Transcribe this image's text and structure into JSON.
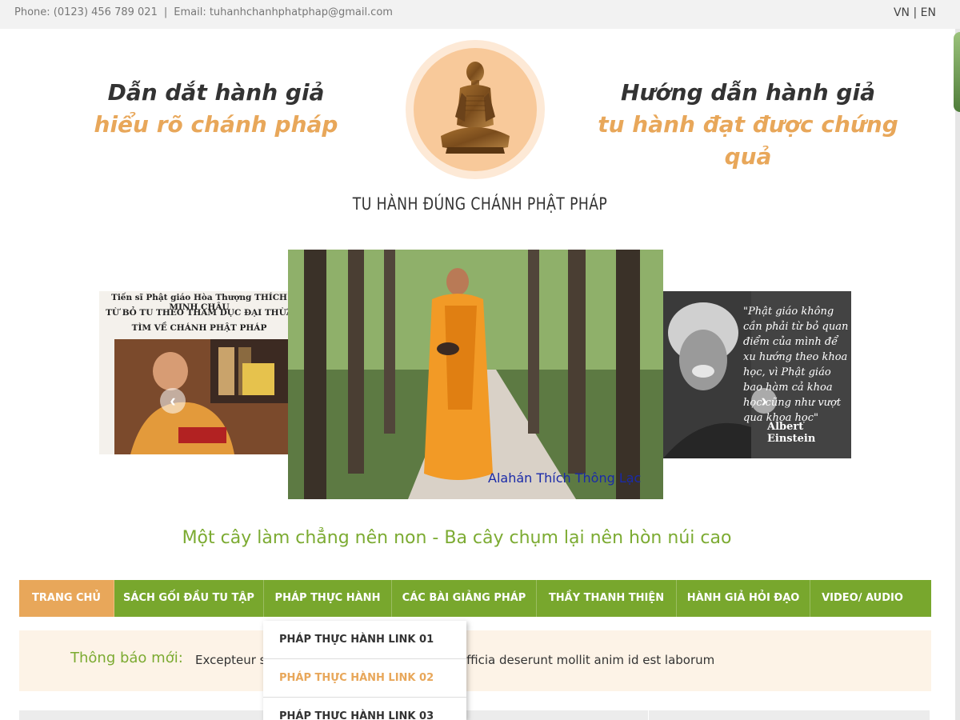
{
  "topbar": {
    "phone": "Phone: (0123) 456 789 021",
    "separator": "|",
    "email": "Email: tuhanhchanhphatphap@gmail.com",
    "lang_vn": "VN",
    "lang_sep": "|",
    "lang_en": "EN"
  },
  "header": {
    "left_line1": "Dẫn dắt hành giả",
    "left_line2": "hiểu rõ chánh pháp",
    "right_line1": "Hướng dẫn hành giả",
    "right_line2": "tu hành đạt được chứng quả",
    "logo_title": "TU HÀNH ĐÚNG CHÁNH PHẬT PHÁP"
  },
  "slider": {
    "left_caption_1": "Tiến sĩ Phật giáo Hòa Thượng THÍCH MINH CHÂU",
    "left_caption_2": "TỪ BỎ TU THEO THAM DỤC ĐẠI THỪA",
    "left_caption_3": "TÌM VỀ CHÁNH PHẬT PHÁP",
    "center_caption": "Alahán Thích Thông Lạc",
    "right_quote": "\"Phật giáo không cần phải từ bỏ quan điểm của mình để xu hướng theo khoa học, vì Phật giáo bao hàm cả khoa học cũng như vượt qua khoa học\"",
    "right_author": "Albert Einstein",
    "prev": "‹",
    "next": "›"
  },
  "proverb": "Một cây làm chẳng nên non - Ba cây chụm lại nên hòn núi cao",
  "nav": {
    "items": [
      {
        "label": "TRANG CHỦ"
      },
      {
        "label": "SÁCH GỐI ĐẦU TU TẬP"
      },
      {
        "label": "PHÁP THỰC HÀNH"
      },
      {
        "label": "CÁC BÀI GIẢNG PHÁP"
      },
      {
        "label": "THẦY THANH THIỆN"
      },
      {
        "label": "HÀNH GIẢ HỎI ĐẠO"
      },
      {
        "label": "VIDEO/ AUDIO"
      }
    ],
    "dropdown": [
      {
        "label": "PHÁP THỰC HÀNH LINK 01"
      },
      {
        "label": "PHÁP THỰC HÀNH LINK 02"
      },
      {
        "label": "PHÁP THỰC HÀNH LINK 03"
      }
    ]
  },
  "notice": {
    "label": "Thông báo mới:",
    "text_before": "Excepteur si",
    "text_after": "sunt in culpa qui officia deserunt mollit anim id est laborum"
  },
  "colors": {
    "brand_green": "#78a72d",
    "accent_orange": "#e8a75a",
    "proverb_green": "#7cab32",
    "notice_bg": "#fdf3e7"
  }
}
